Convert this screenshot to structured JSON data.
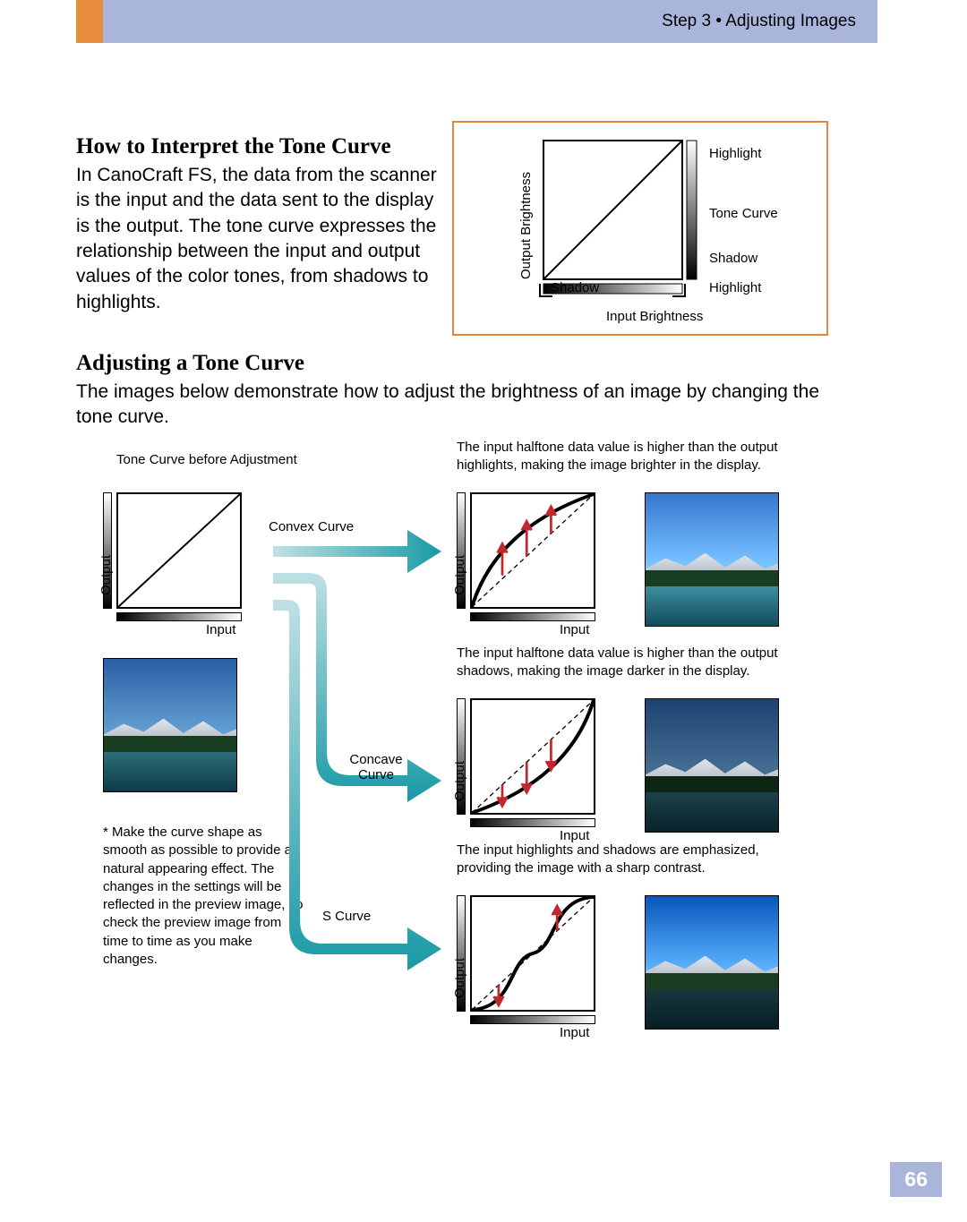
{
  "header": {
    "title": "Step 3 • Adjusting Images"
  },
  "section1": {
    "heading": "How to Interpret the Tone Curve",
    "body": "In CanoCraft FS, the data from the scanner is the input and the data sent to the display is the output. The tone curve expresses the relationship between the input and output values of the color tones, from shadows to highlights."
  },
  "section2": {
    "heading": "Adjusting a Tone Curve",
    "body": "The images below demonstrate how to adjust the brightness of an image by changing the tone curve."
  },
  "diagram_box": {
    "output_axis": "Output Brightness",
    "input_axis": "Input Brightness",
    "shadow_y": "Shadow",
    "highlight_y": "Highlight",
    "shadow_x": "Shadow",
    "highlight_x": "Highlight",
    "curve_label": "Tone Curve"
  },
  "before_label": "Tone Curve before Adjustment",
  "axis": {
    "output": "Output",
    "input": "Input"
  },
  "convex": {
    "flow_label": "Convex Curve",
    "desc": "The input halftone data value is higher than the output highlights, making the image brighter in the display."
  },
  "concave": {
    "flow_label": "Concave Curve",
    "desc": "The input halftone data value is higher than the output shadows, making the image darker in the display."
  },
  "scurve": {
    "flow_label": "S Curve",
    "desc": "The input highlights and shadows are emphasized, providing the image with a sharp contrast."
  },
  "footnote": "* Make the curve shape as smooth as possible to provide a natural appearing effect. The changes in the settings will be reflected in the preview image, so check the preview image from time to time as you make changes.",
  "page_number": "66",
  "chart_data": [
    {
      "type": "line",
      "name": "identity",
      "title": "Tone Curve before Adjustment",
      "xlabel": "Input",
      "ylabel": "Output",
      "x": [
        0,
        50,
        100
      ],
      "y": [
        0,
        50,
        100
      ]
    },
    {
      "type": "line",
      "name": "convex",
      "title": "Convex Curve",
      "xlabel": "Input",
      "ylabel": "Output",
      "x": [
        0,
        20,
        50,
        80,
        100
      ],
      "y": [
        0,
        48,
        75,
        92,
        100
      ],
      "reference_dashed": [
        [
          0,
          0
        ],
        [
          100,
          100
        ]
      ]
    },
    {
      "type": "line",
      "name": "concave",
      "title": "Concave Curve",
      "xlabel": "Input",
      "ylabel": "Output",
      "x": [
        0,
        20,
        50,
        80,
        100
      ],
      "y": [
        0,
        8,
        25,
        52,
        100
      ],
      "reference_dashed": [
        [
          0,
          0
        ],
        [
          100,
          100
        ]
      ]
    },
    {
      "type": "line",
      "name": "s-curve",
      "title": "S Curve",
      "xlabel": "Input",
      "ylabel": "Output",
      "x": [
        0,
        20,
        40,
        50,
        60,
        80,
        100
      ],
      "y": [
        0,
        8,
        28,
        50,
        72,
        92,
        100
      ],
      "reference_dashed": [
        [
          0,
          0
        ],
        [
          100,
          100
        ]
      ]
    }
  ]
}
